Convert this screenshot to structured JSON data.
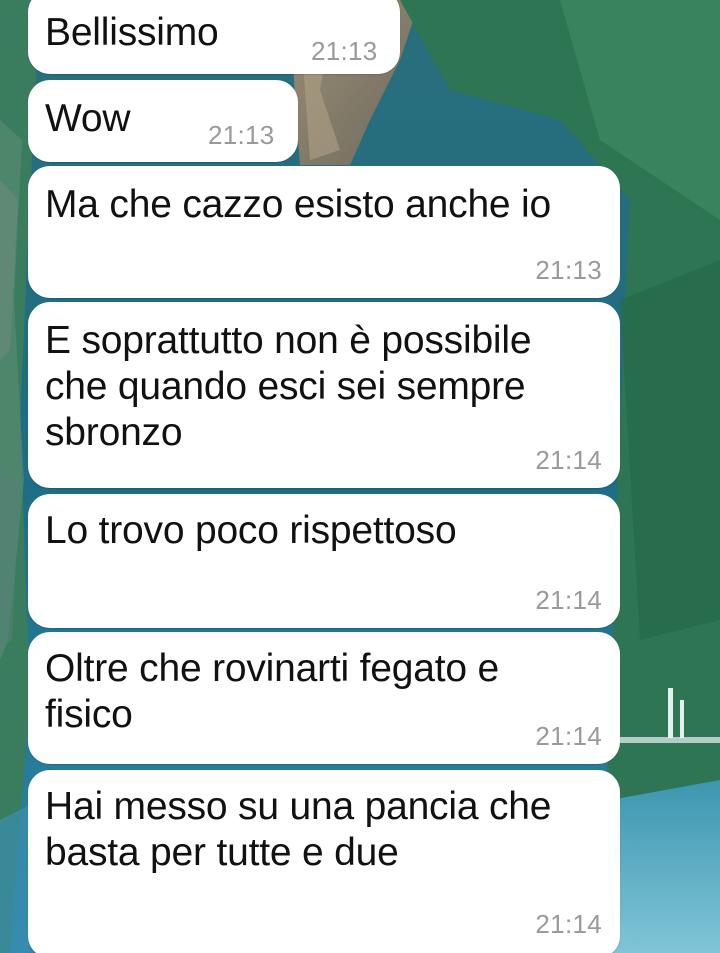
{
  "colors": {
    "bubble": "#ffffff",
    "text": "#111111",
    "timestamp": "#9a9a9a",
    "wallpaper_primary": "#1b6f86",
    "wallpaper_forest": "#2e7a55"
  },
  "messages": [
    {
      "text": "Bellissimo",
      "time": "21:13"
    },
    {
      "text": "Wow",
      "time": "21:13"
    },
    {
      "text": "Ma che cazzo esisto anche io",
      "time": "21:13"
    },
    {
      "text": "E soprattutto non è possibile che quando esci sei sempre sbronzo",
      "time": "21:14"
    },
    {
      "text": "Lo trovo poco rispettoso",
      "time": "21:14"
    },
    {
      "text": "Oltre che rovinarti fegato e fisico",
      "time": "21:14"
    },
    {
      "text": "Hai messo su una pancia che basta per tutte e due",
      "time": "21:14"
    }
  ]
}
